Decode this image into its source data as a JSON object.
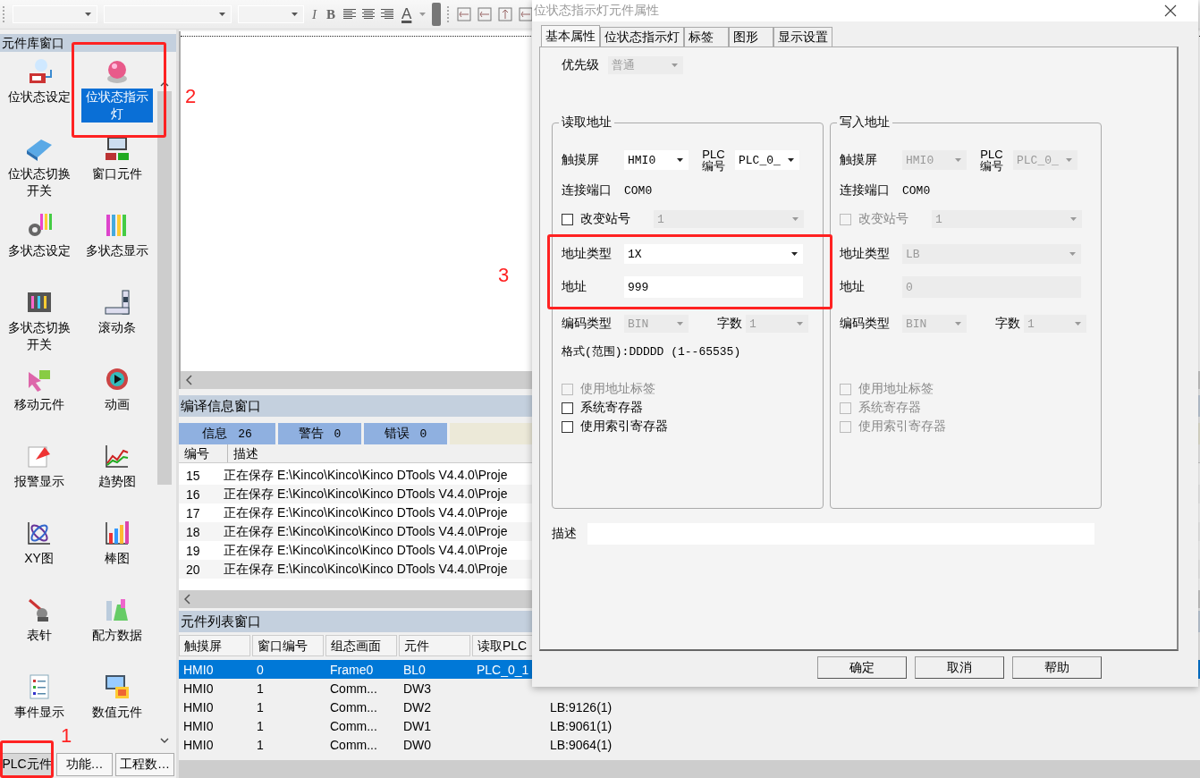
{
  "toolbar": {
    "format_buttons": [
      {
        "label": "I",
        "kind": "italic"
      },
      {
        "label": "B",
        "kind": "bold"
      }
    ],
    "font_color": "A"
  },
  "library": {
    "title": "元件库窗口",
    "items": [
      {
        "label": "位状态设定",
        "selected": false
      },
      {
        "label": "位状态指示灯",
        "selected": true
      },
      {
        "label": "位状态切换开关",
        "selected": false
      },
      {
        "label": "窗口元件",
        "selected": false
      },
      {
        "label": "多状态设定",
        "selected": false
      },
      {
        "label": "多状态显示",
        "selected": false
      },
      {
        "label": "多状态切换开关",
        "selected": false
      },
      {
        "label": "滚动条",
        "selected": false
      },
      {
        "label": "移动元件",
        "selected": false
      },
      {
        "label": "动画",
        "selected": false
      },
      {
        "label": "报警显示",
        "selected": false
      },
      {
        "label": "趋势图",
        "selected": false
      },
      {
        "label": "XY图",
        "selected": false
      },
      {
        "label": "棒图",
        "selected": false
      },
      {
        "label": "表针",
        "selected": false
      },
      {
        "label": "配方数据",
        "selected": false
      },
      {
        "label": "事件显示",
        "selected": false
      },
      {
        "label": "数值元件",
        "selected": false
      }
    ],
    "tabs": [
      {
        "label": "PLC元件",
        "selected": true
      },
      {
        "label": "功能…",
        "selected": false
      },
      {
        "label": "工程数…",
        "selected": false
      }
    ]
  },
  "compile": {
    "title": "编译信息窗口",
    "filters": [
      {
        "label": "信息",
        "count": "26"
      },
      {
        "label": "警告",
        "count": "0"
      },
      {
        "label": "错误",
        "count": "0"
      }
    ],
    "columns": [
      "编号",
      "描述"
    ],
    "rows": [
      {
        "no": "15",
        "text": "正在保存 E:\\Kinco\\Kinco\\Kinco DTools V4.4.0\\Proje"
      },
      {
        "no": "16",
        "text": "正在保存 E:\\Kinco\\Kinco\\Kinco DTools V4.4.0\\Proje"
      },
      {
        "no": "17",
        "text": "正在保存 E:\\Kinco\\Kinco\\Kinco DTools V4.4.0\\Proje"
      },
      {
        "no": "18",
        "text": "正在保存 E:\\Kinco\\Kinco\\Kinco DTools V4.4.0\\Proje"
      },
      {
        "no": "19",
        "text": "正在保存 E:\\Kinco\\Kinco\\Kinco DTools V4.4.0\\Proje"
      },
      {
        "no": "20",
        "text": "正在保存 E:\\Kinco\\Kinco\\Kinco DTools V4.4.0\\Proje"
      }
    ]
  },
  "components": {
    "title": "元件列表窗口",
    "columns": [
      "触摸屏",
      "窗口编号",
      "组态画面",
      "元件",
      "读取PLC"
    ],
    "rows": [
      {
        "cells": [
          "HMI0",
          "0",
          "Frame0",
          "BL0",
          "PLC_0_1"
        ],
        "selected": true
      },
      {
        "cells": [
          "HMI0",
          "1",
          "Comm...",
          "DW3",
          null
        ],
        "selected": false
      },
      {
        "cells": [
          "HMI0",
          "1",
          "Comm...",
          "DW2",
          null
        ],
        "column_6": "LB:9126(1)",
        "selected": false
      },
      {
        "cells": [
          "HMI0",
          "1",
          "Comm...",
          "DW1",
          null
        ],
        "column_6": "LB:9061(1)",
        "selected": false
      },
      {
        "cells": [
          "HMI0",
          "1",
          "Comm...",
          "DW0",
          null
        ],
        "column_6": "LB:9064(1)",
        "selected": false
      }
    ]
  },
  "dialog": {
    "title": "位状态指示灯元件属性",
    "tabs": [
      {
        "label": "基本属性",
        "selected": true
      },
      {
        "label": "位状态指示灯",
        "selected": false
      },
      {
        "label": "标签",
        "selected": false
      },
      {
        "label": "图形",
        "selected": false
      },
      {
        "label": "显示设置",
        "selected": false
      }
    ],
    "priority": {
      "label": "优先级",
      "value": "普通",
      "disabled": true
    },
    "groups": [
      {
        "title": "读取地址",
        "hmi": {
          "label": "触摸屏",
          "value": "HMI0",
          "disabled": false
        },
        "plc": {
          "label": "PLC 编号",
          "value": "PLC_0_",
          "disabled": false
        },
        "port": {
          "label": "连接端口",
          "value": "COM0"
        },
        "station": {
          "label": "改变站号",
          "checked": false,
          "disabled": false,
          "value": "1"
        },
        "address_type": {
          "label": "地址类型",
          "value": "1X",
          "disabled": false
        },
        "address": {
          "label": "地址",
          "value": "999",
          "disabled": false
        },
        "encoding": {
          "label": "编码类型",
          "value": "BIN",
          "disabled": true
        },
        "words": {
          "label": "字数",
          "value": "1",
          "disabled": true
        },
        "format": "格式(范围):DDDDD (1--65535)",
        "options": [
          {
            "label": "使用地址标签",
            "checked": false,
            "disabled": true
          },
          {
            "label": "系统寄存器",
            "checked": false,
            "disabled": false
          },
          {
            "label": "使用索引寄存器",
            "checked": false,
            "disabled": false
          }
        ]
      },
      {
        "title": "写入地址",
        "hmi": {
          "label": "触摸屏",
          "value": "HMI0",
          "disabled": true
        },
        "plc": {
          "label": "PLC 编号",
          "value": "PLC_0_",
          "disabled": true
        },
        "port": {
          "label": "连接端口",
          "value": "COM0"
        },
        "station": {
          "label": "改变站号",
          "checked": false,
          "disabled": true,
          "value": "1"
        },
        "address_type": {
          "label": "地址类型",
          "value": "LB",
          "disabled": true
        },
        "address": {
          "label": "地址",
          "value": "0",
          "disabled": true
        },
        "encoding": {
          "label": "编码类型",
          "value": "BIN",
          "disabled": true
        },
        "words": {
          "label": "字数",
          "value": "1",
          "disabled": true
        },
        "options": [
          {
            "label": "使用地址标签",
            "checked": false,
            "disabled": true
          },
          {
            "label": "系统寄存器",
            "checked": false,
            "disabled": true
          },
          {
            "label": "使用索引寄存器",
            "checked": false,
            "disabled": true
          }
        ]
      }
    ],
    "description_label": "描述",
    "buttons": [
      "确定",
      "取消",
      "帮助"
    ]
  },
  "annotations": [
    "1",
    "2",
    "3"
  ]
}
